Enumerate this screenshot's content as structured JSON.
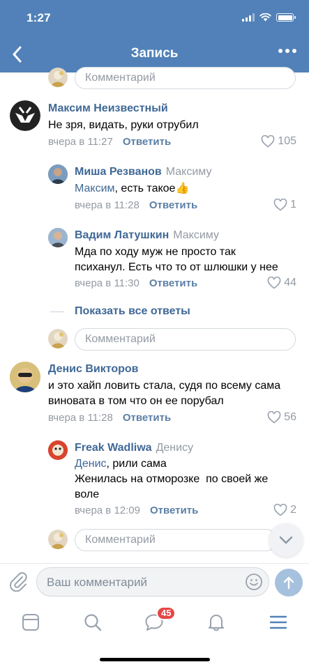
{
  "status_bar": {
    "time": "1:27"
  },
  "nav": {
    "title": "Запись"
  },
  "colors": {
    "header": "#5181b8",
    "link": "#3f6896",
    "meta": "#939aa3",
    "badge": "#e64646"
  },
  "comment_placeholder": "Комментарий",
  "comments": [
    {
      "author": "Максим Неизвестный",
      "text": "Не зря, видать, руки отрубил",
      "time": "вчера в 11:27",
      "reply_label": "Ответить",
      "likes": "105"
    },
    {
      "author": "Миша Резванов",
      "reply_to": "Максиму",
      "mention": "Максим",
      "text": ", есть такое👍",
      "time": "вчера в 11:28",
      "reply_label": "Ответить",
      "likes": "1"
    },
    {
      "author": "Вадим Латушкин",
      "reply_to": "Максиму",
      "text_line1": "Мда по ходу муж не просто так",
      "text_line2": "психанул. Есть что то от шлюшки у нее",
      "time": "вчера в 11:30",
      "reply_label": "Ответить",
      "likes": "44"
    },
    {
      "author": "Денис Викторов",
      "text_line1": "и это хайп ловить стала, судя по всему сама",
      "text_line2": "виновата в том что он ее порубал",
      "time": "вчера в 11:28",
      "reply_label": "Ответить",
      "likes": "56"
    },
    {
      "author": "Freak Wadliwa",
      "reply_to": "Денису",
      "mention": "Денис",
      "text_line1": ", рили сама",
      "text_line2": "Женилась на отморозке  по своей же",
      "text_line3": "воле",
      "time": "вчера в 12:09",
      "reply_label": "Ответить",
      "likes": "2"
    }
  ],
  "show_all_replies": "Показать все ответы",
  "compose": {
    "placeholder": "Ваш комментарий"
  },
  "tabbar": {
    "items": [
      {
        "icon": "news-feed-icon"
      },
      {
        "icon": "search-icon"
      },
      {
        "icon": "messages-icon",
        "badge": "45"
      },
      {
        "icon": "notifications-bell-icon"
      },
      {
        "icon": "menu-icon",
        "active": true
      }
    ]
  }
}
